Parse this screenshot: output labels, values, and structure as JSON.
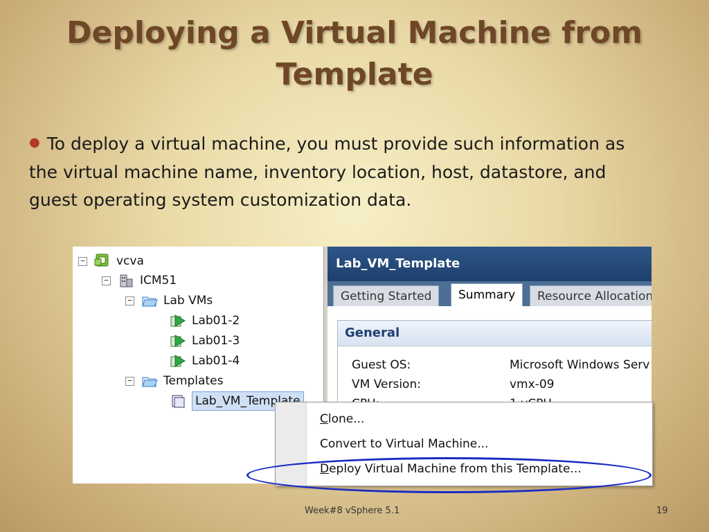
{
  "slide": {
    "title_line1": "Deploying a Virtual Machine from",
    "title_line2": "Template",
    "bullet": "To deploy a virtual machine, you must provide such information as the virtual machine name, inventory location, host, datastore, and guest operating system customization data.",
    "footer_center": "Week#8 vSphere 5.1",
    "page_number": "19",
    "title_color": "#6e4727",
    "bullet_color": "#b23a2a",
    "ring_color": "#1a2cc4"
  },
  "tree": {
    "root": "vcva",
    "datacenter": "ICM51",
    "folder_labvms": "Lab VMs",
    "vms": [
      "Lab01-2",
      "Lab01-3",
      "Lab01-4"
    ],
    "folder_templates": "Templates",
    "template": "Lab_VM_Template",
    "expander_symbol": "−"
  },
  "panel": {
    "title": "Lab_VM_Template",
    "tabs": [
      "Getting Started",
      "Summary",
      "Resource Allocation"
    ],
    "active_tab": "Summary",
    "general_title": "General",
    "rows": [
      {
        "label": "Guest OS:",
        "value": "Microsoft Windows Serv"
      },
      {
        "label": "VM Version:",
        "value": "vmx-09"
      },
      {
        "label": "CPU:",
        "value": "1 vCPU"
      }
    ]
  },
  "context_menu": {
    "items": [
      {
        "underline": "C",
        "rest": "lone..."
      },
      {
        "underline": "",
        "rest": "Convert to Virtual Machine..."
      },
      {
        "underline": "D",
        "rest": "eploy Virtual Machine from this Template..."
      }
    ]
  }
}
